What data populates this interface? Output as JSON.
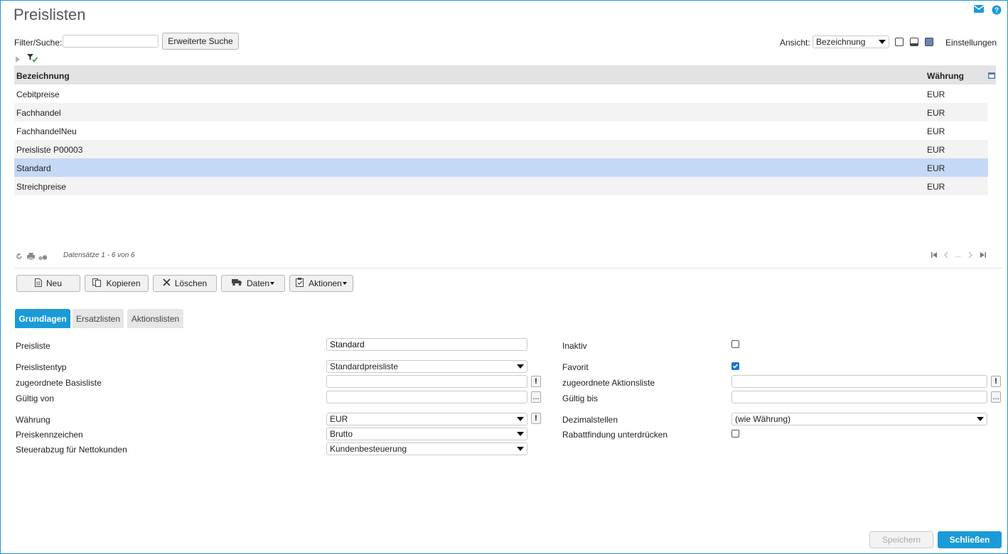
{
  "app": {
    "title": "Preislisten"
  },
  "filter": {
    "label": "Filter/Suche:",
    "value": "",
    "advanced_label": "Erweiterte Suche"
  },
  "view": {
    "label": "Ansicht:",
    "selected": "Bezeichnung",
    "settings_label": "Einstellungen"
  },
  "table": {
    "headers": {
      "name": "Bezeichnung",
      "currency": "Währung"
    },
    "rows": [
      {
        "name": "Cebitpreise",
        "currency": "EUR"
      },
      {
        "name": "Fachhandel",
        "currency": "EUR"
      },
      {
        "name": "FachhandelNeu",
        "currency": "EUR"
      },
      {
        "name": "Preisliste P00003",
        "currency": "EUR"
      },
      {
        "name": "Standard",
        "currency": "EUR",
        "selected": true
      },
      {
        "name": "Streichpreise",
        "currency": "EUR"
      }
    ],
    "records_text": "Datensätze 1 - 6 von 6",
    "pager_ellipsis": "..."
  },
  "toolbar": {
    "new": "Neu",
    "copy": "Kopieren",
    "delete": "Löschen",
    "data": "Daten",
    "actions": "Aktionen"
  },
  "tabs": [
    {
      "label": "Grundlagen"
    },
    {
      "label": "Ersatzlisten"
    },
    {
      "label": "Aktionslisten"
    }
  ],
  "form": {
    "preisliste": {
      "label": "Preisliste",
      "value": "Standard"
    },
    "preislistentyp": {
      "label": "Preislistentyp",
      "value": "Standardpreisliste"
    },
    "basisliste": {
      "label": "zugeordnete Basisliste",
      "value": ""
    },
    "gueltig_von": {
      "label": "Gültig von",
      "value": ""
    },
    "waehrung": {
      "label": "Währung",
      "value": "EUR"
    },
    "preiskennzeichen": {
      "label": "Preiskennzeichen",
      "value": "Brutto"
    },
    "steuerabzug": {
      "label": "Steuerabzug für Nettokunden",
      "value": "Kundenbesteuerung"
    },
    "inaktiv": {
      "label": "Inaktiv",
      "checked": false
    },
    "favorit": {
      "label": "Favorit",
      "checked": true
    },
    "aktionsliste": {
      "label": "zugeordnete Aktionsliste",
      "value": ""
    },
    "gueltig_bis": {
      "label": "Gültig bis",
      "value": ""
    },
    "dezimalstellen": {
      "label": "Dezimalstellen",
      "value": "(wie Währung)"
    },
    "rabattfindung": {
      "label": "Rabattfindung unterdrücken",
      "checked": false
    }
  },
  "buttons": {
    "ellipsis": "...",
    "exclamation": "!"
  },
  "footer": {
    "save": "Speichern",
    "close": "Schließen"
  },
  "colors": {
    "accent": "#1a9bd7",
    "selected_row": "#c5d9f6"
  }
}
